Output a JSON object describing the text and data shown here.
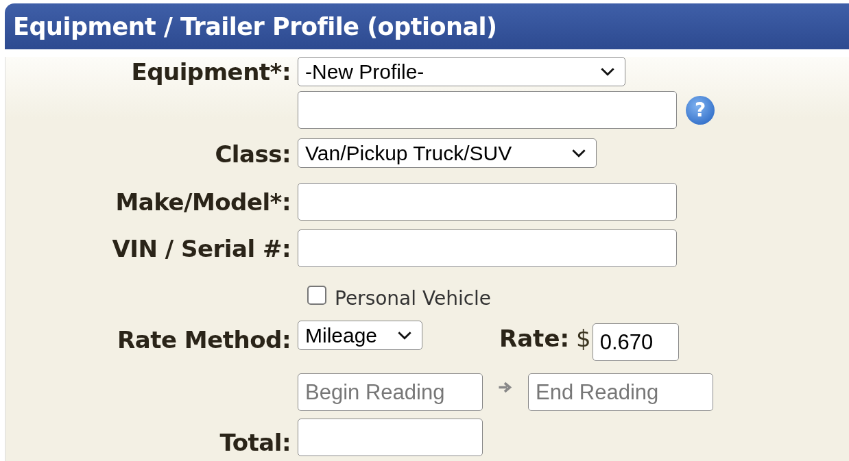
{
  "header": {
    "title": "Equipment / Trailer Profile (optional)"
  },
  "equipment": {
    "label": "Equipment*:",
    "value": "-New Profile-",
    "help": "?"
  },
  "class": {
    "label": "Class:",
    "value": "Van/Pickup Truck/SUV"
  },
  "make_model": {
    "label": "Make/Model*:"
  },
  "vin": {
    "label": "VIN / Serial #:"
  },
  "personal_vehicle": {
    "label": "Personal Vehicle",
    "checked": false
  },
  "rate_method": {
    "label": "Rate Method:",
    "value": "Mileage"
  },
  "rate": {
    "label": "Rate:",
    "currency": "$",
    "value": "0.670"
  },
  "begin_reading": {
    "placeholder": "Begin Reading"
  },
  "end_reading": {
    "placeholder": "End Reading"
  },
  "total": {
    "label": "Total:"
  }
}
